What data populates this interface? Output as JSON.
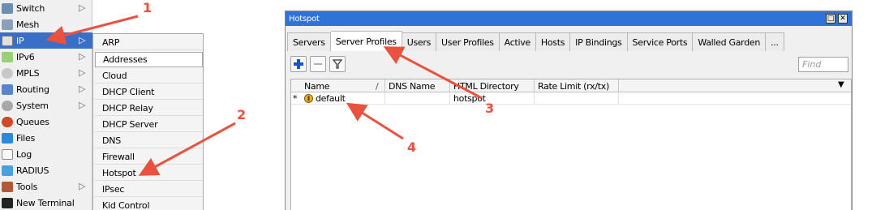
{
  "left_menu": {
    "items": [
      {
        "label": "Switch",
        "icon": "switch-icon",
        "arrow": "▷"
      },
      {
        "label": "Mesh",
        "icon": "mesh-icon",
        "arrow": ""
      },
      {
        "label": "IP",
        "icon": "ip-icon",
        "arrow": "▷"
      },
      {
        "label": "IPv6",
        "icon": "ipv6-icon",
        "arrow": "▷"
      },
      {
        "label": "MPLS",
        "icon": "mpls-icon",
        "arrow": "▷"
      },
      {
        "label": "Routing",
        "icon": "routing-icon",
        "arrow": "▷"
      },
      {
        "label": "System",
        "icon": "system-icon",
        "arrow": "▷"
      },
      {
        "label": "Queues",
        "icon": "queues-icon",
        "arrow": ""
      },
      {
        "label": "Files",
        "icon": "files-icon",
        "arrow": ""
      },
      {
        "label": "Log",
        "icon": "log-icon",
        "arrow": ""
      },
      {
        "label": "RADIUS",
        "icon": "radius-icon",
        "arrow": ""
      },
      {
        "label": "Tools",
        "icon": "tools-icon",
        "arrow": "▷"
      },
      {
        "label": "New Terminal",
        "icon": "terminal-icon",
        "arrow": ""
      }
    ],
    "selected": "IP"
  },
  "ip_submenu": {
    "items": [
      "ARP",
      "Addresses",
      "Cloud",
      "DHCP Client",
      "DHCP Relay",
      "DHCP Server",
      "DNS",
      "Firewall",
      "Hotspot",
      "IPsec",
      "Kid Control"
    ],
    "active": "Addresses"
  },
  "hotspot_window": {
    "title": "Hotspot",
    "restore_button": "□",
    "close_button": "✕",
    "tabs": [
      "Servers",
      "Server Profiles",
      "Users",
      "User Profiles",
      "Active",
      "Hosts",
      "IP Bindings",
      "Service Ports",
      "Walled Garden",
      "..."
    ],
    "active_tab": "Server Profiles",
    "toolbar": {
      "add": "add-icon",
      "remove": "remove-icon",
      "filter": "filter-icon"
    },
    "find_placeholder": "Find",
    "columns": [
      "Name",
      "DNS Name",
      "HTML Directory",
      "Rate Limit (rx/tx)"
    ],
    "sort_indicator": "/",
    "dropdown": "▼",
    "rows": [
      {
        "marker": "*",
        "name": "default",
        "dns_name": "",
        "html_directory": "hotspot",
        "rate_limit": ""
      }
    ]
  },
  "annotations": [
    "1",
    "2",
    "3",
    "4"
  ],
  "colors": {
    "title_bar": "#2f73d8",
    "selection": "#3a6fc8",
    "annotation": "#e8523f",
    "add_icon": "#1a55c8"
  }
}
